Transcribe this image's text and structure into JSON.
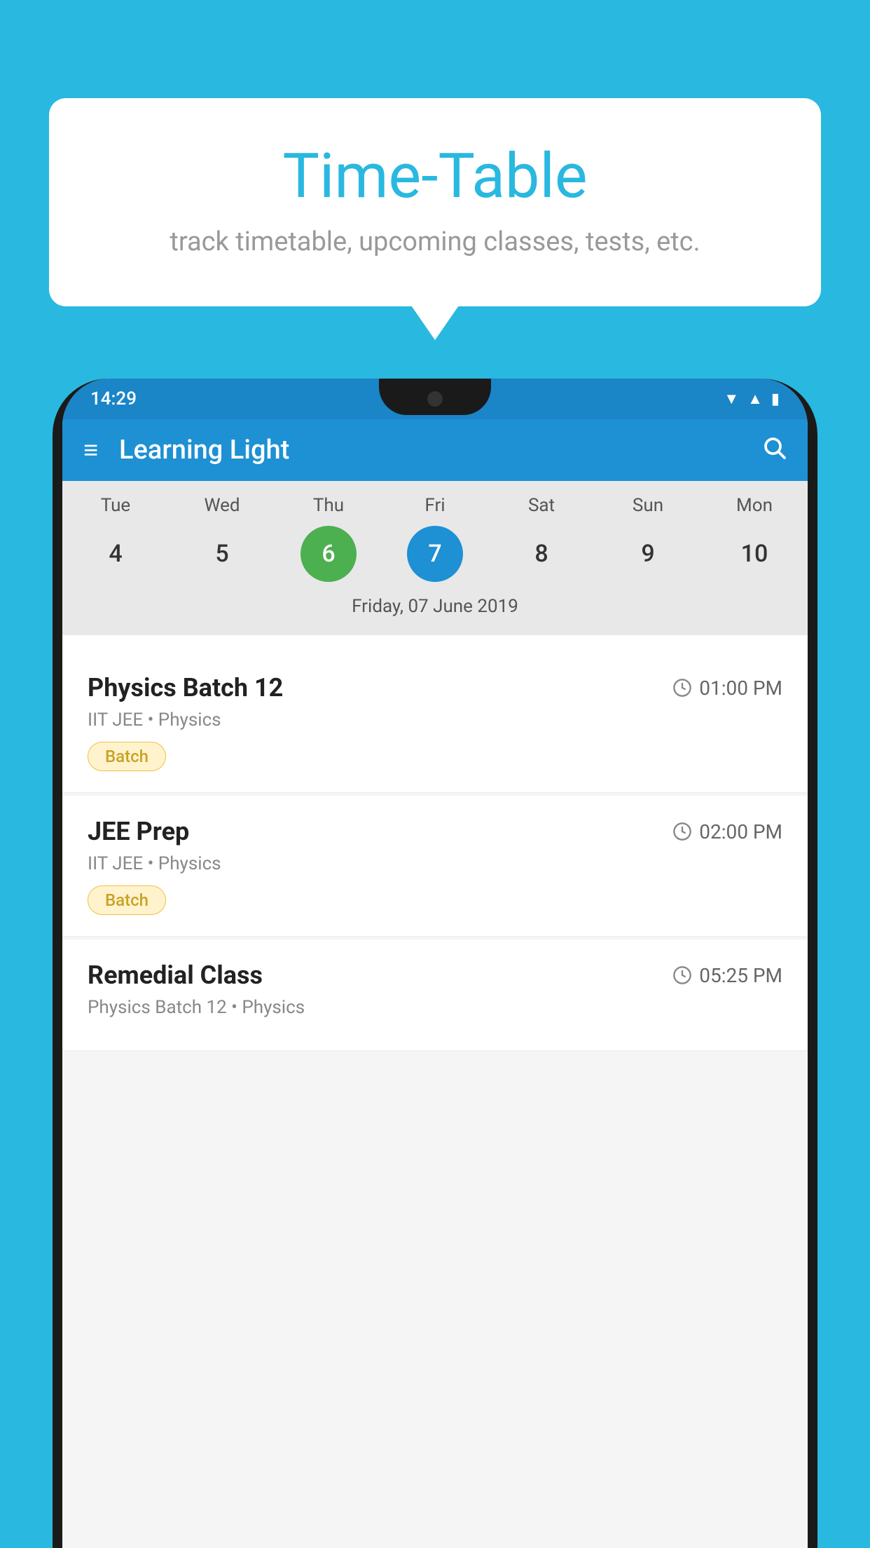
{
  "background": {
    "color": "#29b8e0"
  },
  "speech_bubble": {
    "title": "Time-Table",
    "subtitle": "track timetable, upcoming classes, tests, etc."
  },
  "status_bar": {
    "time": "14:29"
  },
  "app_header": {
    "title": "Learning Light",
    "menu_icon": "≡",
    "search_icon": "🔍"
  },
  "calendar": {
    "day_headers": [
      "Tue",
      "Wed",
      "Thu",
      "Fri",
      "Sat",
      "Sun",
      "Mon"
    ],
    "day_numbers": [
      {
        "number": "4",
        "state": "normal"
      },
      {
        "number": "5",
        "state": "normal"
      },
      {
        "number": "6",
        "state": "today"
      },
      {
        "number": "7",
        "state": "selected"
      },
      {
        "number": "8",
        "state": "normal"
      },
      {
        "number": "9",
        "state": "normal"
      },
      {
        "number": "10",
        "state": "normal"
      }
    ],
    "selected_date_label": "Friday, 07 June 2019"
  },
  "schedule_items": [
    {
      "title": "Physics Batch 12",
      "time": "01:00 PM",
      "subtitle": "IIT JEE • Physics",
      "badge": "Batch"
    },
    {
      "title": "JEE Prep",
      "time": "02:00 PM",
      "subtitle": "IIT JEE • Physics",
      "badge": "Batch"
    },
    {
      "title": "Remedial Class",
      "time": "05:25 PM",
      "subtitle": "Physics Batch 12 • Physics",
      "badge": null
    }
  ]
}
